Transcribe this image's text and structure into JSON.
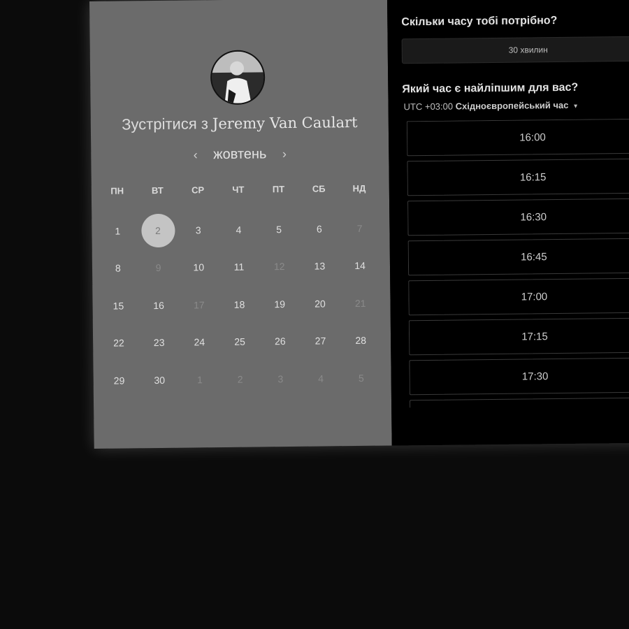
{
  "profile": {
    "title_prefix": "Зустрітися з",
    "name": "Jeremy Van Caulart"
  },
  "calendar": {
    "month": "жовтень",
    "prev_icon": "chevron-left-icon",
    "next_icon": "chevron-right-icon",
    "weekdays": [
      "ПН",
      "ВТ",
      "СР",
      "ЧТ",
      "ПТ",
      "СБ",
      "НД"
    ],
    "days": [
      {
        "d": "1",
        "state": "available"
      },
      {
        "d": "2",
        "state": "selected"
      },
      {
        "d": "3",
        "state": "available"
      },
      {
        "d": "4",
        "state": "available"
      },
      {
        "d": "5",
        "state": "available"
      },
      {
        "d": "6",
        "state": "available"
      },
      {
        "d": "7",
        "state": "disabled"
      },
      {
        "d": "8",
        "state": "available"
      },
      {
        "d": "9",
        "state": "disabled"
      },
      {
        "d": "10",
        "state": "available"
      },
      {
        "d": "11",
        "state": "available"
      },
      {
        "d": "12",
        "state": "disabled"
      },
      {
        "d": "13",
        "state": "available"
      },
      {
        "d": "14",
        "state": "available"
      },
      {
        "d": "15",
        "state": "available"
      },
      {
        "d": "16",
        "state": "available"
      },
      {
        "d": "17",
        "state": "disabled"
      },
      {
        "d": "18",
        "state": "available"
      },
      {
        "d": "19",
        "state": "available"
      },
      {
        "d": "20",
        "state": "available"
      },
      {
        "d": "21",
        "state": "disabled"
      },
      {
        "d": "22",
        "state": "available"
      },
      {
        "d": "23",
        "state": "available"
      },
      {
        "d": "24",
        "state": "available"
      },
      {
        "d": "25",
        "state": "available"
      },
      {
        "d": "26",
        "state": "available"
      },
      {
        "d": "27",
        "state": "available"
      },
      {
        "d": "28",
        "state": "available"
      },
      {
        "d": "29",
        "state": "available"
      },
      {
        "d": "30",
        "state": "available"
      },
      {
        "d": "1",
        "state": "disabled"
      },
      {
        "d": "2",
        "state": "disabled"
      },
      {
        "d": "3",
        "state": "disabled"
      },
      {
        "d": "4",
        "state": "disabled"
      },
      {
        "d": "5",
        "state": "disabled"
      }
    ]
  },
  "booking": {
    "duration_question": "Скільки часу тобі потрібно?",
    "duration_value": "30 хвилин",
    "time_question": "Який час є найліпшим для вас?",
    "timezone_offset": "UTC +03:00",
    "timezone_name": "Східноєвропейський час",
    "timezone_caret_icon": "caret-down-icon",
    "slots": [
      "16:00",
      "16:15",
      "16:30",
      "16:45",
      "17:00",
      "17:15",
      "17:30",
      ""
    ]
  },
  "colors": {
    "page_bg": "#0b0b0b",
    "left_panel_bg": "#6b6b6b",
    "right_panel_bg": "#000000",
    "selected_day_bg": "#c4c4c4"
  }
}
